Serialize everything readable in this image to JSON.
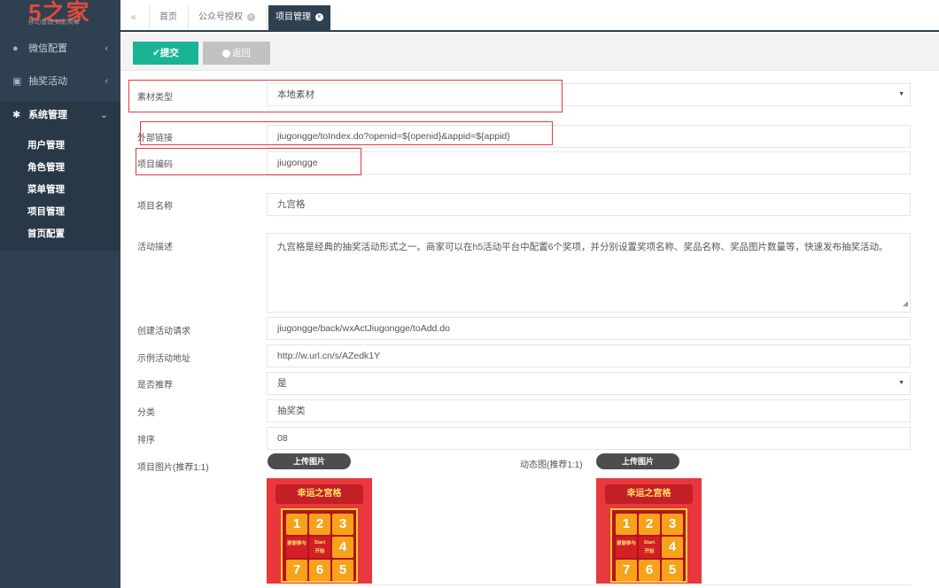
{
  "sidebar": {
    "brand": "5之家",
    "slogan": "移动营销 如此简单",
    "menu": [
      {
        "label": "微信配置",
        "icon": "wechat-icon"
      },
      {
        "label": "抽奖活动",
        "icon": "gift-icon"
      },
      {
        "label": "系统管理",
        "icon": "gear-icon"
      }
    ],
    "submenu": [
      "用户管理",
      "角色管理",
      "菜单管理",
      "项目管理",
      "首页配置"
    ]
  },
  "tabs": {
    "back_icon": "«",
    "items": [
      "首页",
      "公众号授权",
      "项目管理"
    ]
  },
  "toolbar": {
    "submit_label": "✔提交",
    "back_label": "返回"
  },
  "form": {
    "material_type": {
      "label": "素材类型",
      "value": "本地素材"
    },
    "external_link": {
      "label": "外部链接",
      "value": "jiugongge/toIndex.do?openid=${openid}&appid=${appid}"
    },
    "project_code": {
      "label": "项目编码",
      "value": "jiugongge"
    },
    "project_name": {
      "label": "项目名称",
      "value": "九宫格"
    },
    "description": {
      "label": "活动描述",
      "value": "九宫格是经典的抽奖活动形式之一。商家可以在h5活动平台中配置6个奖项，并分别设置奖项名称、奖品名称、奖品图片数量等，快速发布抽奖活动。"
    },
    "create_request": {
      "label": "创建活动请求",
      "value": "jiugongge/back/wxActJiugongge/toAdd.do"
    },
    "example_url": {
      "label": "示例活动地址",
      "value": "http://w.url.cn/s/AZedk1Y"
    },
    "recommended": {
      "label": "是否推荐",
      "value": "是"
    },
    "category": {
      "label": "分类",
      "value": "抽奖类"
    },
    "sort": {
      "label": "排序",
      "value": "08"
    },
    "project_image": {
      "label": "项目图片(推荐1:1)",
      "upload_label": "上传图片"
    },
    "animated_image": {
      "label": "动态图(推荐1:1)",
      "upload_label": "上传图片"
    }
  },
  "preview": {
    "title": "幸运之宫格",
    "numbers": [
      "1",
      "2",
      "3",
      "4",
      "5",
      "6",
      "7"
    ],
    "center_top": "Start",
    "center_bottom": "开始",
    "side_cell": "谢谢参与"
  },
  "colors": {
    "sidebar": "#2f4050",
    "submit": "#1ab394",
    "highlight_box": "#e4393c"
  }
}
